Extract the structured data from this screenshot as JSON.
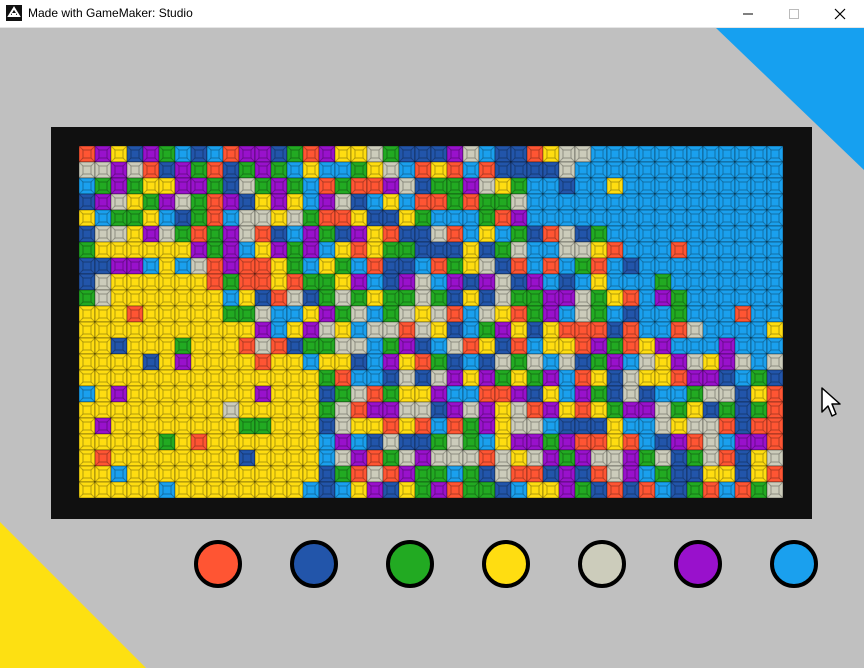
{
  "window": {
    "title": "Made with GameMaker: Studio"
  },
  "icons": {
    "app": "gamemaker-icon",
    "minimize": "minimize-icon",
    "maximize": "maximize-icon",
    "close": "close-icon",
    "cursor": "mouse-pointer-icon"
  },
  "colors": {
    "background": "#c0c0c0",
    "frame": "#101010",
    "corner_top_right": "#16a0f0",
    "corner_bottom_left": "#fde012"
  },
  "board": {
    "columns": 44,
    "rows": 22,
    "palette": [
      "#ff5533",
      "#2255aa",
      "#22aa22",
      "#ffdd11",
      "#ccccbb",
      "#9911cc",
      "#1aa0ee"
    ],
    "palette_names": [
      "red",
      "blue",
      "green",
      "yellow",
      "beige",
      "purple",
      "cyan"
    ]
  },
  "swatches": [
    {
      "name": "red",
      "color": "#ff5533"
    },
    {
      "name": "blue",
      "color": "#2255aa"
    },
    {
      "name": "green",
      "color": "#22aa22"
    },
    {
      "name": "yellow",
      "color": "#ffdd11"
    },
    {
      "name": "beige",
      "color": "#ccccbb"
    },
    {
      "name": "purple",
      "color": "#9911cc"
    },
    {
      "name": "cyan",
      "color": "#1aa0ee"
    }
  ]
}
